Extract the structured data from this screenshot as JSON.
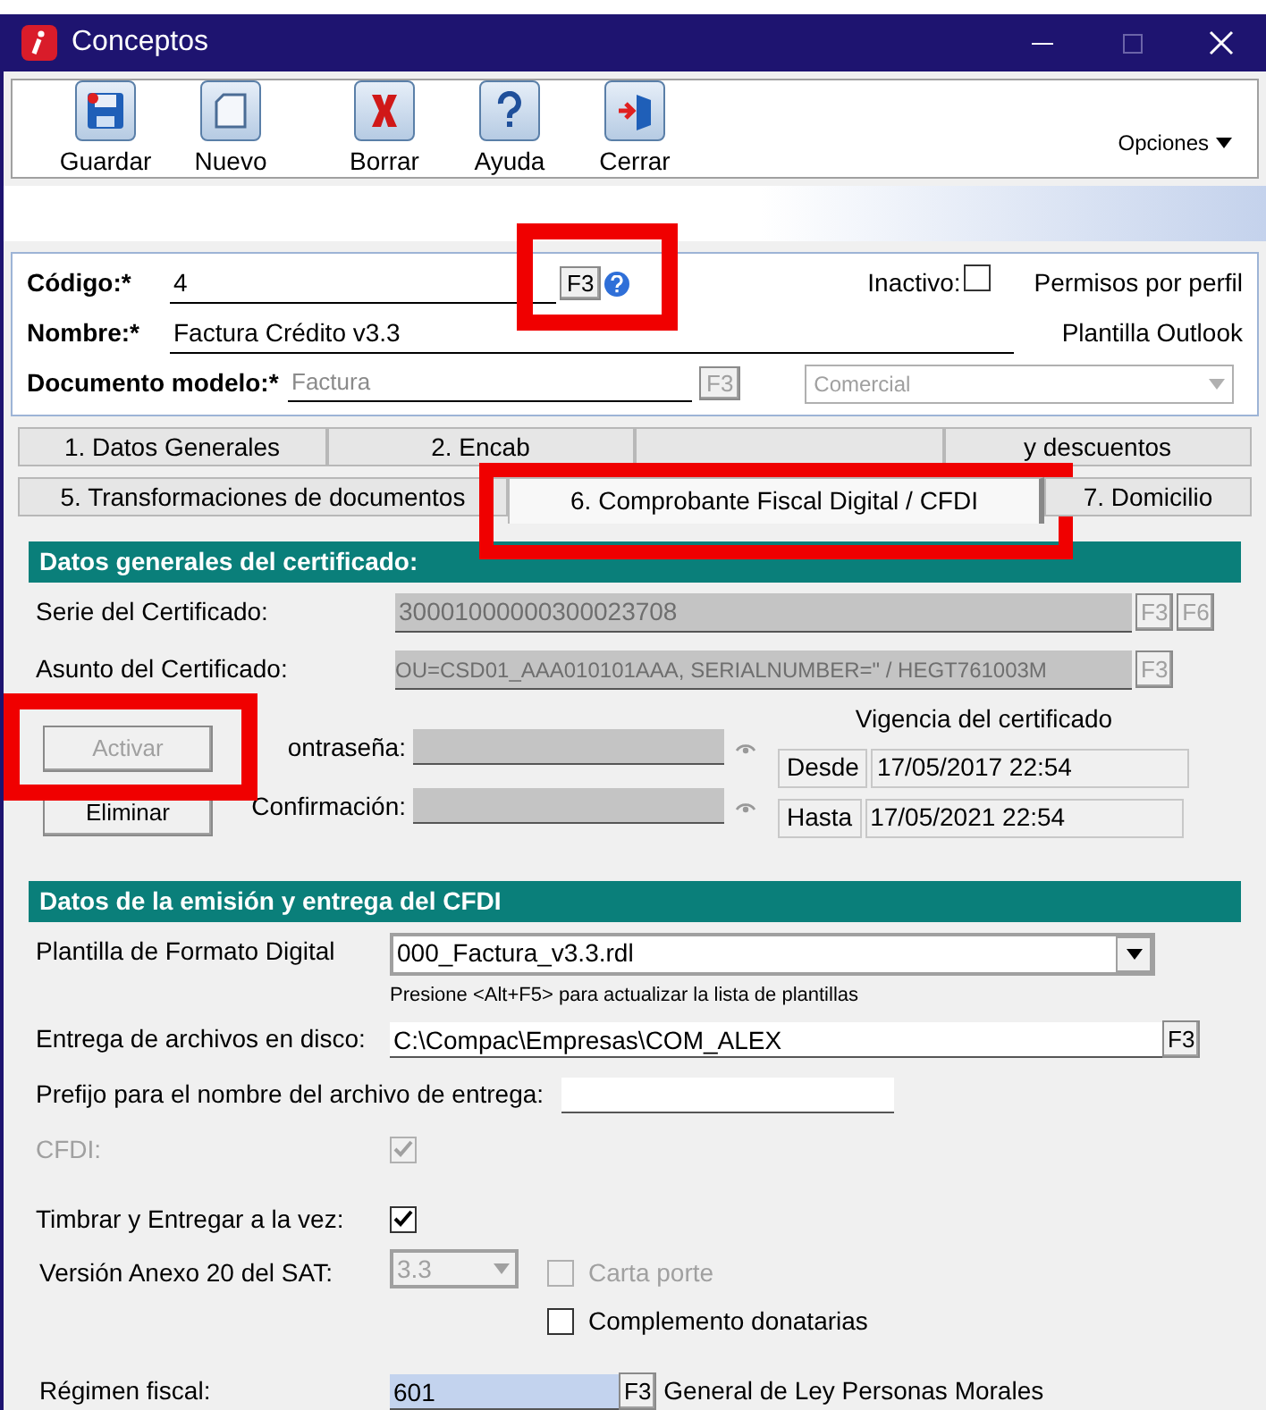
{
  "window": {
    "title": "Conceptos"
  },
  "toolbar": [
    {
      "label": "Guardar",
      "kind": "save"
    },
    {
      "label": "Nuevo",
      "kind": "new"
    },
    {
      "label": "Borrar",
      "kind": "delete"
    },
    {
      "label": "Ayuda",
      "kind": "help"
    },
    {
      "label": "Cerrar",
      "kind": "close"
    }
  ],
  "options_menu": "Opciones",
  "header": {
    "codigo_label": "Código:*",
    "codigo_value": "4",
    "codigo_button": "F3",
    "inactivo_label": "Inactivo:",
    "inactivo_checked": false,
    "permisos_link": "Permisos por perfil",
    "nombre_label": "Nombre:*",
    "nombre_value": "Factura Crédito v3.3",
    "plantilla_link": "Plantilla Outlook",
    "documento_label": "Documento modelo:*",
    "documento_value": "Factura",
    "documento_button": "F3",
    "tipo_value": "Comercial"
  },
  "tabs": [
    [
      {
        "label": "1. Datos Generales",
        "selected": false
      },
      {
        "label": "2. Encab",
        "selected": false
      },
      {
        "selected": false
      },
      {
        "label": "y descuentos",
        "selected": false
      }
    ],
    [
      {
        "label": "5. Transformaciones de documentos",
        "selected": false
      },
      {
        "label": "6. Comprobante Fiscal Digital / CFDI",
        "selected": true
      },
      {
        "label": "7. Domicilio",
        "selected": false
      }
    ]
  ],
  "certificado": {
    "title": "Datos generales del certificado:",
    "serie_label": "Serie del Certificado:",
    "serie_value": "30001000000300023708",
    "serie_buttons": [
      "F3",
      "F6"
    ],
    "asunto_label": "Asunto del Certificado:",
    "asunto_value": "OU=CSD01_AAA010101AAA, SERIALNUMBER=\" / HEGT761003M",
    "asunto_button": "F3",
    "activar": "Activar",
    "eliminar": "Eliminar",
    "contrasena_label": "ontraseña:",
    "confirmacion_label": "Confirmación:",
    "vigencia_title": "Vigencia del certificado",
    "desde_label": "Desde",
    "desde_value": "17/05/2017 22:54",
    "hasta_label": "Hasta",
    "hasta_value": "17/05/2021 22:54"
  },
  "emision": {
    "title": "Datos de la emisión y entrega del CFDI",
    "plantilla_label": "Plantilla de Formato Digital",
    "plantilla_value": "000_Factura_v3.3.rdl",
    "plantilla_hint": "Presione <Alt+F5> para actualizar la lista de plantillas",
    "entrega_label": "Entrega de archivos en disco:",
    "entrega_value": "C:\\Compac\\Empresas\\COM_ALEX",
    "entrega_button": "F3",
    "prefijo_label": "Prefijo para el nombre del archivo de entrega:",
    "cfdi_label": "CFDI:",
    "cfdi_checked": true,
    "timbrar_label": "Timbrar y Entregar a la vez:",
    "timbrar_checked": true,
    "version_label": "Versión Anexo 20 del SAT:",
    "version_value": "3.3",
    "options": [
      {
        "label": "Carta porte",
        "checked": false,
        "disabled": true
      },
      {
        "label": "Complemento donatarias",
        "checked": false,
        "disabled": false
      }
    ],
    "regimen_label": "Régimen fiscal:",
    "regimen_value": "601",
    "regimen_button": "F3",
    "regimen_desc": "General de Ley Personas Morales"
  }
}
